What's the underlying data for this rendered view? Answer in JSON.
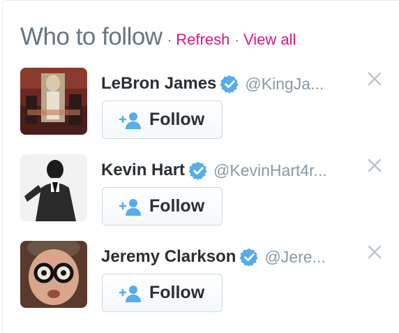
{
  "widget": {
    "title": "Who to follow",
    "separator": "·",
    "refresh_label": "Refresh",
    "view_all_label": "View all"
  },
  "accent_color": "#e0157a",
  "verified_color": "#55acee",
  "suggestions": [
    {
      "name": "LeBron James",
      "handle": "@KingJa...",
      "verified": true,
      "follow_label": "Follow",
      "avatar_icon": "lebron-james-avatar"
    },
    {
      "name": "Kevin Hart",
      "handle": "@KevinHart4r...",
      "verified": true,
      "follow_label": "Follow",
      "avatar_icon": "kevin-hart-avatar"
    },
    {
      "name": "Jeremy Clarkson",
      "handle": "@Jere...",
      "verified": true,
      "follow_label": "Follow",
      "avatar_icon": "jeremy-clarkson-avatar"
    }
  ]
}
